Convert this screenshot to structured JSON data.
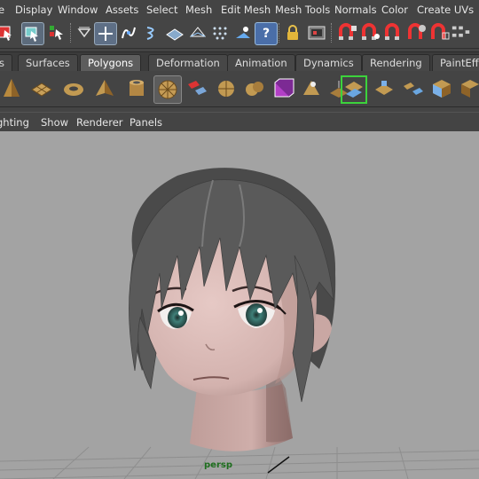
{
  "menubar": {
    "items": [
      "e",
      "Display",
      "Window",
      "Assets",
      "Select",
      "Mesh",
      "Edit Mesh",
      "Mesh Tools",
      "Normals",
      "Color",
      "Create UVs"
    ]
  },
  "toolbar": {
    "icons": [
      "select-tool-icon",
      "select-object-icon",
      "select-component-icon",
      "snap-filter-icon",
      "snap-grid-icon",
      "snap-curve-icon",
      "snap-point-icon",
      "snap-view-plane-icon",
      "make-live-icon",
      "snap-vertex-icon",
      "snap-projected-icon",
      "help-icon",
      "lock-icon",
      "history-icon",
      "render-icon",
      "ipr-render-icon",
      "render-settings-icon",
      "hypershade-icon",
      "render-view-icon"
    ],
    "help_glyph": "?"
  },
  "tabs": {
    "items": [
      "s",
      "Surfaces",
      "Polygons",
      "Deformation",
      "Animation",
      "Dynamics",
      "Rendering",
      "PaintEffe"
    ],
    "active": "Polygons"
  },
  "shelf": {
    "icons": [
      "poly-cone-icon",
      "poly-plane-icon",
      "poly-torus-icon",
      "poly-pyramid-icon",
      "poly-pipe-icon",
      "poly-soccerball-icon",
      "separate-icon",
      "extract-icon",
      "combine-icon",
      "booleans-icon",
      "smooth-icon",
      "poly-cube-icon",
      "sculpt-tool-icon",
      "extrude-icon",
      "bridge-icon",
      "append-icon",
      "split-icon",
      "bevel-icon",
      "poly-cube-wire-icon"
    ]
  },
  "panel_menu": {
    "items": [
      "ghting",
      "Show",
      "Renderer",
      "Panels"
    ]
  },
  "viewport": {
    "camera": "persp",
    "background": "#a3a3a3",
    "hair_color": "#5a5a5a",
    "skin_color": "#d9b9b5",
    "eye_color": "#3f7f78"
  }
}
